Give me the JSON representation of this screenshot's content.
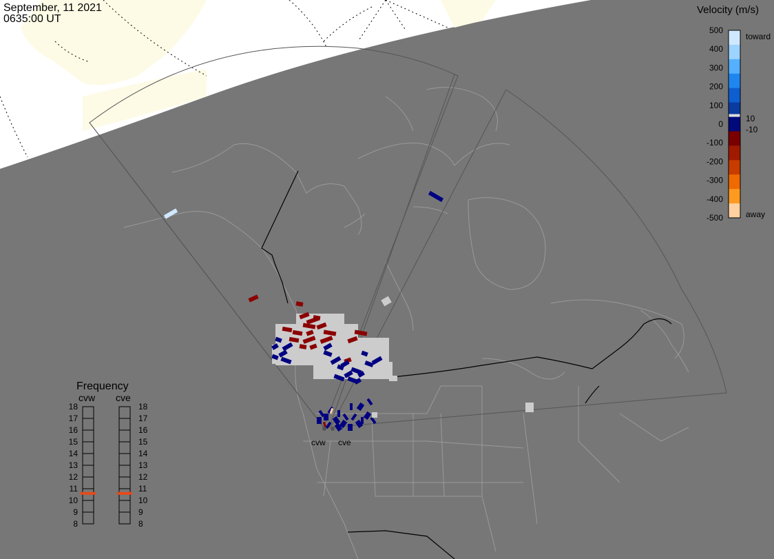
{
  "header": {
    "date": "September, 11 2021",
    "time": "0635:00 UT"
  },
  "colors": {
    "night": "#777777",
    "day": "#fdfbe6",
    "ocean_day": "#ffffff",
    "coast": "#a8a8a8",
    "border": "#000000",
    "fov": "#555555",
    "ground_scatter": "#cccccc",
    "blue_dark": "#000080",
    "red_dark": "#8b0000",
    "freq_mark": "#e64a19"
  },
  "velocity_scale": {
    "title": "Velocity (m/s)",
    "ticks": [
      "500",
      "400",
      "300",
      "200",
      "100",
      "0",
      "-100",
      "-200",
      "-300",
      "-400",
      "-500"
    ],
    "inner_labels": [
      "10",
      "-10"
    ],
    "toward_label": "toward",
    "away_label": "away",
    "colors": [
      "#cfe8ff",
      "#9dd3ff",
      "#55b0ff",
      "#1f86f0",
      "#0d5ed0",
      "#0a3ba0",
      "#000a7a",
      "#7a0000",
      "#a01a00",
      "#c83c00",
      "#ef6a00",
      "#ff9a20",
      "#ffd0a0"
    ]
  },
  "frequency_panel": {
    "title": "Frequency",
    "radars": [
      "cvw",
      "cve"
    ],
    "levels": [
      "18",
      "17",
      "16",
      "15",
      "14",
      "13",
      "12",
      "11",
      "10",
      "9",
      "8"
    ],
    "cvw_value": 10.6,
    "cve_value": 10.6
  },
  "radar_sites": [
    {
      "id": "cvw",
      "label": "cvw"
    },
    {
      "id": "cve",
      "label": "cve"
    }
  ]
}
